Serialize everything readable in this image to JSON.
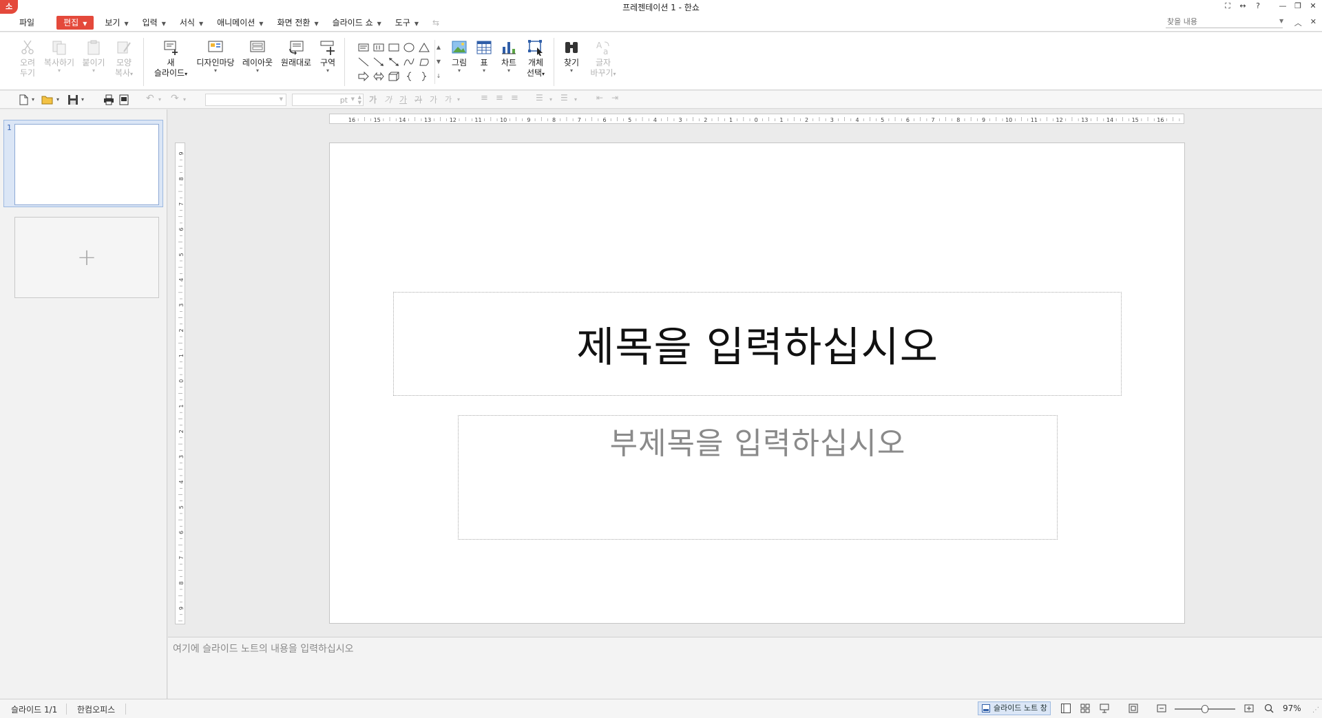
{
  "window": {
    "logo": "소",
    "title": "프레젠테이션 1 - 한쇼"
  },
  "menu": {
    "file": "파일",
    "items": [
      {
        "label": "편집",
        "active": true
      },
      {
        "label": "보기"
      },
      {
        "label": "입력"
      },
      {
        "label": "서식"
      },
      {
        "label": "애니메이션"
      },
      {
        "label": "화면 전환"
      },
      {
        "label": "슬라이드 쇼"
      },
      {
        "label": "도구"
      }
    ],
    "search_placeholder": "찾을 내용"
  },
  "ribbon": {
    "cut": [
      "오려",
      "두기"
    ],
    "copy": "복사하기",
    "paste": "붙이기",
    "format_painter": [
      "모양",
      "복사"
    ],
    "new_slide": [
      "새",
      "슬라이드"
    ],
    "design": "디자인마당",
    "layout": "레이아웃",
    "reset": "원래대로",
    "section": "구역",
    "picture": "그림",
    "table": "표",
    "chart": "차트",
    "select_objects": [
      "개체",
      "선택"
    ],
    "find": "찾기",
    "replace": [
      "글자",
      "바꾸기"
    ]
  },
  "format_toolbar": {
    "font_size_unit": "pt"
  },
  "slides": {
    "current_number": "1",
    "add_symbol": "+"
  },
  "slide": {
    "title_placeholder": "제목을 입력하십시오",
    "subtitle_placeholder": "부제목을 입력하십시오"
  },
  "notes": {
    "placeholder": "여기에 슬라이드 노트의 내용을 입력하십시오"
  },
  "status": {
    "slide_count": "슬라이드 1/1",
    "app_name": "한컴오피스",
    "notes_toggle": "슬라이드 노트 창",
    "zoom": "97%"
  },
  "ruler": {
    "horizontal": [
      "16",
      "15",
      "14",
      "13",
      "12",
      "11",
      "10",
      "9",
      "8",
      "7",
      "6",
      "5",
      "4",
      "3",
      "2",
      "1",
      "0",
      "1",
      "2",
      "3",
      "4",
      "5",
      "6",
      "7",
      "8",
      "9",
      "10",
      "11",
      "12",
      "13",
      "14",
      "15",
      "16"
    ],
    "vertical": [
      "9",
      "8",
      "7",
      "6",
      "5",
      "4",
      "3",
      "2",
      "1",
      "0",
      "1",
      "2",
      "3",
      "4",
      "5",
      "6",
      "7",
      "8",
      "9"
    ]
  },
  "colors": {
    "accent": "#e4493b",
    "selection": "#dbe6f6"
  }
}
